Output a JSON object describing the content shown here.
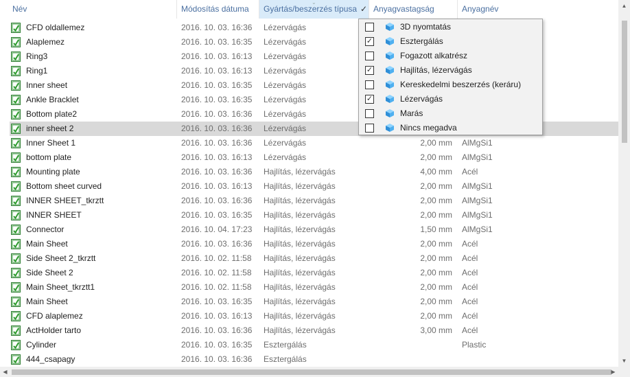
{
  "columns": {
    "name": "Név",
    "modified": "Módosítás dátuma",
    "type": "Gyártás/beszerzés típusa",
    "thickness": "Anyagvastagság",
    "material": "Anyagnév"
  },
  "type_filter_active_icon": "checkmark-icon",
  "rows": [
    {
      "name": "CFD oldallemez",
      "date": "2016. 10. 03. 16:36",
      "type": "Lézervágás",
      "thickness": "",
      "material": ""
    },
    {
      "name": "Alaplemez",
      "date": "2016. 10. 03. 16:35",
      "type": "Lézervágás",
      "thickness": "",
      "material": ""
    },
    {
      "name": "Ring3",
      "date": "2016. 10. 03. 16:13",
      "type": "Lézervágás",
      "thickness": "",
      "material": ""
    },
    {
      "name": "Ring1",
      "date": "2016. 10. 03. 16:13",
      "type": "Lézervágás",
      "thickness": "",
      "material": ""
    },
    {
      "name": "Inner sheet",
      "date": "2016. 10. 03. 16:35",
      "type": "Lézervágás",
      "thickness": "",
      "material": ""
    },
    {
      "name": "Ankle Bracklet",
      "date": "2016. 10. 03. 16:35",
      "type": "Lézervágás",
      "thickness": "",
      "material": ""
    },
    {
      "name": "Bottom plate2",
      "date": "2016. 10. 03. 16:36",
      "type": "Lézervágás",
      "thickness": "",
      "material": ""
    },
    {
      "name": "inner sheet 2",
      "date": "2016. 10. 03. 16:36",
      "type": "Lézervágás",
      "thickness": "",
      "material": "",
      "selected": true
    },
    {
      "name": "Inner Sheet 1",
      "date": "2016. 10. 03. 16:36",
      "type": "Lézervágás",
      "thickness": "2,00 mm",
      "material": "AlMgSi1"
    },
    {
      "name": "bottom plate",
      "date": "2016. 10. 03. 16:13",
      "type": "Lézervágás",
      "thickness": "2,00 mm",
      "material": "AlMgSi1"
    },
    {
      "name": "Mounting plate",
      "date": "2016. 10. 03. 16:36",
      "type": "Hajlítás, lézervágás",
      "thickness": "4,00 mm",
      "material": "Acél"
    },
    {
      "name": "Bottom sheet curved",
      "date": "2016. 10. 03. 16:13",
      "type": "Hajlítás, lézervágás",
      "thickness": "2,00 mm",
      "material": "AlMgSi1"
    },
    {
      "name": "INNER SHEET_tkrztt",
      "date": "2016. 10. 03. 16:36",
      "type": "Hajlítás, lézervágás",
      "thickness": "2,00 mm",
      "material": "AlMgSi1"
    },
    {
      "name": "INNER SHEET",
      "date": "2016. 10. 03. 16:35",
      "type": "Hajlítás, lézervágás",
      "thickness": "2,00 mm",
      "material": "AlMgSi1"
    },
    {
      "name": "Connector",
      "date": "2016. 10. 04. 17:23",
      "type": "Hajlítás, lézervágás",
      "thickness": "1,50 mm",
      "material": "AlMgSi1"
    },
    {
      "name": "Main Sheet",
      "date": "2016. 10. 03. 16:36",
      "type": "Hajlítás, lézervágás",
      "thickness": "2,00 mm",
      "material": "Acél"
    },
    {
      "name": "Side Sheet 2_tkrztt",
      "date": "2016. 10. 02. 11:58",
      "type": "Hajlítás, lézervágás",
      "thickness": "2,00 mm",
      "material": "Acél"
    },
    {
      "name": "Side Sheet 2",
      "date": "2016. 10. 02. 11:58",
      "type": "Hajlítás, lézervágás",
      "thickness": "2,00 mm",
      "material": "Acél"
    },
    {
      "name": "Main Sheet_tkrztt1",
      "date": "2016. 10. 02. 11:58",
      "type": "Hajlítás, lézervágás",
      "thickness": "2,00 mm",
      "material": "Acél"
    },
    {
      "name": "Main Sheet",
      "date": "2016. 10. 03. 16:35",
      "type": "Hajlítás, lézervágás",
      "thickness": "2,00 mm",
      "material": "Acél"
    },
    {
      "name": "CFD alaplemez",
      "date": "2016. 10. 03. 16:13",
      "type": "Hajlítás, lézervágás",
      "thickness": "2,00 mm",
      "material": "Acél"
    },
    {
      "name": "ActHolder tarto",
      "date": "2016. 10. 03. 16:36",
      "type": "Hajlítás, lézervágás",
      "thickness": "3,00 mm",
      "material": "Acél"
    },
    {
      "name": "Cylinder",
      "date": "2016. 10. 03. 16:35",
      "type": "Esztergálás",
      "thickness": "",
      "material": "Plastic"
    },
    {
      "name": "444_csapagy",
      "date": "2016. 10. 03. 16:36",
      "type": "Esztergálás",
      "thickness": "",
      "material": ""
    }
  ],
  "filter_options": [
    {
      "label": "3D nyomtatás",
      "checked": false
    },
    {
      "label": "Esztergálás",
      "checked": true
    },
    {
      "label": "Fogazott alkatrész",
      "checked": false
    },
    {
      "label": "Hajlítás, lézervágás",
      "checked": true
    },
    {
      "label": "Kereskedelmi beszerzés (keráru)",
      "checked": false
    },
    {
      "label": "Lézervágás",
      "checked": true
    },
    {
      "label": "Marás",
      "checked": false
    },
    {
      "label": "Nincs megadva",
      "checked": false
    }
  ],
  "colors": {
    "header_text": "#4a6fa0",
    "active_header_bg": "#d9ebf9",
    "selected_row_bg": "#d9d9d9",
    "icon_green": "#2e9c2e",
    "cube_blue": "#3aa0e0"
  }
}
